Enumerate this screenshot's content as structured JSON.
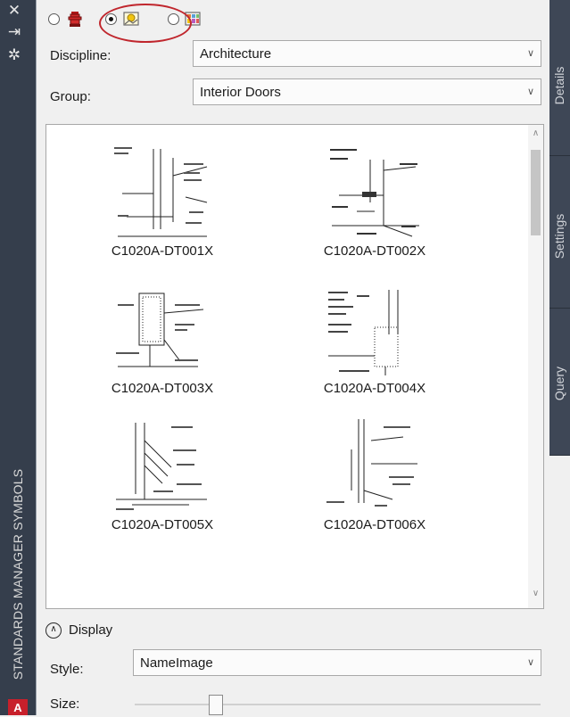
{
  "window": {
    "vertical_title": "STANDARDS MANAGER SYMBOLS",
    "buttons": {
      "close": "✕",
      "pin": "⇥",
      "properties": "✲"
    },
    "app_badge": "A"
  },
  "side_tabs": [
    "Details",
    "Settings",
    "Query"
  ],
  "mode_selector": {
    "options": [
      {
        "icon": "fire-hydrant-icon",
        "selected": false
      },
      {
        "icon": "symbol-image-icon",
        "selected": true
      },
      {
        "icon": "grid-image-icon",
        "selected": false
      }
    ]
  },
  "filters": {
    "discipline_label": "Discipline:",
    "discipline_value": "Architecture",
    "group_label": "Group:",
    "group_value": "Interior Doors"
  },
  "items": [
    {
      "name": "C1020A-DT001X"
    },
    {
      "name": "C1020A-DT002X"
    },
    {
      "name": "C1020A-DT003X"
    },
    {
      "name": "C1020A-DT004X"
    },
    {
      "name": "C1020A-DT005X"
    },
    {
      "name": "C1020A-DT006X"
    }
  ],
  "display": {
    "section_label": "Display",
    "style_label": "Style:",
    "style_value": "NameImage",
    "size_label": "Size:",
    "size_level": 0.2
  },
  "colors": {
    "titlebar": "#353e4c",
    "highlight": "#c0262d",
    "tab": "#3e4756"
  }
}
